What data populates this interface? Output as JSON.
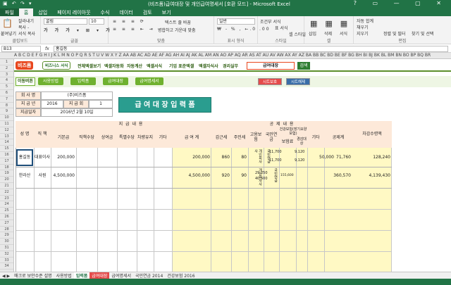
{
  "window": {
    "title": "(비즈폼)급여대장 및 개인급여명세서 [호환 모드] - Microsoft Excel",
    "quick_access": "▣ ↶ ↷ ▾",
    "controls": "? ▭ — ▢ ✕"
  },
  "ribbon_tabs": [
    "파일",
    "홈",
    "삽입",
    "페이지 레이아웃",
    "수식",
    "데이터",
    "검토",
    "보기"
  ],
  "ribbon": {
    "paste": "붙여넣기",
    "cut": "잘라내기",
    "copy": "복사 -",
    "format_painter": "서식 복사",
    "clipboard_label": "클립보드",
    "font_name": "굴림",
    "font_size": "10",
    "font_label": "글꼴",
    "wrap_text": "텍스트 줄 바꿈",
    "merge_center": "병합하고 가운데 맞춤",
    "align_label": "맞춤",
    "number_format": "일반",
    "number_label": "표시 형식",
    "cond_format": "조건부 서식",
    "table_format": "표 서식",
    "cell_style": "셀 스타일",
    "style_label": "스타일",
    "insert": "삽입",
    "delete": "삭제",
    "format": "서식",
    "cells_label": "셀",
    "autosum": "자동 합계",
    "fill": "채우기",
    "clear": "지우기",
    "sort_filter": "정렬 및 필터",
    "find_select": "찾기 및 선택",
    "edit_label": "편집"
  },
  "formula_bar": {
    "name_box": "B13",
    "fx": "fx",
    "value": "홍길동"
  },
  "columns": "A B C D E F G H I J K L M N O P Q R S T U V W X Y Z AA AB AC AD AE AF AG AH AI AJ AK AL AM AN AO AP AQ AR AS AT AU AV AW AX AY AZ BA BB BC BD BE BF BG BH BI BJ BK BL BM BN BO BP BQ BR",
  "rows": [
    "1",
    "2",
    "3",
    "4",
    "5",
    "6",
    "7",
    "8",
    "9",
    "10",
    "11",
    "12",
    "13",
    "14",
    "15",
    "16",
    "17",
    "18",
    "19",
    "20",
    "21",
    "22",
    "23",
    "24",
    "25",
    "26",
    "27",
    "28",
    "29",
    "30",
    "31",
    "32",
    "33",
    "34"
  ],
  "nav": {
    "logo_biz": "비즈폼",
    "logo_sub": "비즈니스 서식",
    "items": [
      "전체엑셀보기",
      "엑셀자동화",
      "자동계산",
      "엑셀서식",
      "기업 표준엑셀",
      "엑셀자식사",
      "경리실무"
    ],
    "doc_title": "급여대장",
    "go_button": "검색"
  },
  "menu": {
    "label": "이동버튼",
    "buttons": [
      "사용방법",
      "입력폼",
      "급여대장",
      "급여명세서"
    ],
    "save_button": "시트보호",
    "unprotect_button": "시트해제"
  },
  "info": {
    "company_label": "회 사 명",
    "company_value": "(주)비즈폼",
    "year_label": "지 급 년",
    "year_value": "2016",
    "count_label": "지 급 회",
    "count_value": "1",
    "date_label": "지급일자",
    "date_value": "2016년 2월 10일",
    "sheet_title": "급 여 대 장 입 력 폼"
  },
  "table": {
    "h_name": "성 명",
    "h_position": "직 책",
    "h_pay_group": "지    급    내    용",
    "h_deduct_group": "공    제    내    용",
    "h_pay_cols": [
      "기본급",
      "직책수당",
      "상여금",
      "특별수당",
      "차량유지",
      "기타",
      "급 여 계"
    ],
    "h_deduct_cols": [
      "갑근세",
      "주민세",
      "고용보험",
      "국민연금",
      "건강보험(장기요양보험)",
      "보험료",
      "경감대상",
      "기타",
      "공제계"
    ],
    "h_net": "차감수령액",
    "rows": [
      {
        "name": "홍길동",
        "position": "대표이사",
        "base": "200,000",
        "total": "200,000",
        "income_tax": "860",
        "resident_tax": "80",
        "employment": "개인회사사",
        "pension": "11,700",
        "pension_note": "국민연금",
        "health": "9,120",
        "etc": "50,000",
        "deduct_total": "71,760",
        "net": "128,240"
      },
      {
        "name": "한라산",
        "position": "사원",
        "base": "4,500,000",
        "total": "4,500,000",
        "income_tax": "920",
        "resident_tax": "90",
        "employment": "개인회사사",
        "pension": "29,250 40,500",
        "pension_note": "국민연금",
        "health": "155,600",
        "etc": "",
        "deduct_total": "360,570",
        "net": "4,139,430"
      }
    ],
    "row1_extra": "11,700",
    "row1_health2": "9,120"
  },
  "sheet_tabs": [
    "매크로 보안수준 설명",
    "사용방법",
    "입력폼",
    "급여대장",
    "급여명세서",
    "국민연금 2014",
    "건강보험 2016"
  ],
  "colors": {
    "excel_green": "#217346",
    "nav_green": "#6fb12f",
    "label_peach": "#fde9d9",
    "yellow": "#fff9c4",
    "title_teal": "#2a9d8f"
  }
}
